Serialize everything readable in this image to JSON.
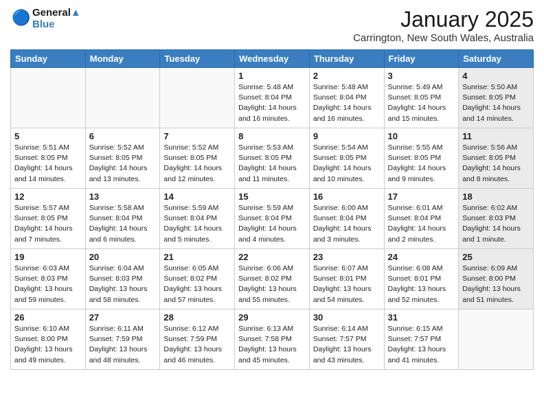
{
  "header": {
    "logo_line1": "General",
    "logo_line2": "Blue",
    "title": "January 2025",
    "subtitle": "Carrington, New South Wales, Australia"
  },
  "weekdays": [
    "Sunday",
    "Monday",
    "Tuesday",
    "Wednesday",
    "Thursday",
    "Friday",
    "Saturday"
  ],
  "weeks": [
    [
      {
        "day": "",
        "info": "",
        "shaded": false,
        "empty": true
      },
      {
        "day": "",
        "info": "",
        "shaded": false,
        "empty": true
      },
      {
        "day": "",
        "info": "",
        "shaded": false,
        "empty": true
      },
      {
        "day": "1",
        "info": "Sunrise: 5:48 AM\nSunset: 8:04 PM\nDaylight: 14 hours\nand 16 minutes.",
        "shaded": false
      },
      {
        "day": "2",
        "info": "Sunrise: 5:48 AM\nSunset: 8:04 PM\nDaylight: 14 hours\nand 16 minutes.",
        "shaded": false
      },
      {
        "day": "3",
        "info": "Sunrise: 5:49 AM\nSunset: 8:05 PM\nDaylight: 14 hours\nand 15 minutes.",
        "shaded": false
      },
      {
        "day": "4",
        "info": "Sunrise: 5:50 AM\nSunset: 8:05 PM\nDaylight: 14 hours\nand 14 minutes.",
        "shaded": true
      }
    ],
    [
      {
        "day": "5",
        "info": "Sunrise: 5:51 AM\nSunset: 8:05 PM\nDaylight: 14 hours\nand 14 minutes.",
        "shaded": false
      },
      {
        "day": "6",
        "info": "Sunrise: 5:52 AM\nSunset: 8:05 PM\nDaylight: 14 hours\nand 13 minutes.",
        "shaded": false
      },
      {
        "day": "7",
        "info": "Sunrise: 5:52 AM\nSunset: 8:05 PM\nDaylight: 14 hours\nand 12 minutes.",
        "shaded": false
      },
      {
        "day": "8",
        "info": "Sunrise: 5:53 AM\nSunset: 8:05 PM\nDaylight: 14 hours\nand 11 minutes.",
        "shaded": false
      },
      {
        "day": "9",
        "info": "Sunrise: 5:54 AM\nSunset: 8:05 PM\nDaylight: 14 hours\nand 10 minutes.",
        "shaded": false
      },
      {
        "day": "10",
        "info": "Sunrise: 5:55 AM\nSunset: 8:05 PM\nDaylight: 14 hours\nand 9 minutes.",
        "shaded": false
      },
      {
        "day": "11",
        "info": "Sunrise: 5:56 AM\nSunset: 8:05 PM\nDaylight: 14 hours\nand 8 minutes.",
        "shaded": true
      }
    ],
    [
      {
        "day": "12",
        "info": "Sunrise: 5:57 AM\nSunset: 8:05 PM\nDaylight: 14 hours\nand 7 minutes.",
        "shaded": false
      },
      {
        "day": "13",
        "info": "Sunrise: 5:58 AM\nSunset: 8:04 PM\nDaylight: 14 hours\nand 6 minutes.",
        "shaded": false
      },
      {
        "day": "14",
        "info": "Sunrise: 5:59 AM\nSunset: 8:04 PM\nDaylight: 14 hours\nand 5 minutes.",
        "shaded": false
      },
      {
        "day": "15",
        "info": "Sunrise: 5:59 AM\nSunset: 8:04 PM\nDaylight: 14 hours\nand 4 minutes.",
        "shaded": false
      },
      {
        "day": "16",
        "info": "Sunrise: 6:00 AM\nSunset: 8:04 PM\nDaylight: 14 hours\nand 3 minutes.",
        "shaded": false
      },
      {
        "day": "17",
        "info": "Sunrise: 6:01 AM\nSunset: 8:04 PM\nDaylight: 14 hours\nand 2 minutes.",
        "shaded": false
      },
      {
        "day": "18",
        "info": "Sunrise: 6:02 AM\nSunset: 8:03 PM\nDaylight: 14 hours\nand 1 minute.",
        "shaded": true
      }
    ],
    [
      {
        "day": "19",
        "info": "Sunrise: 6:03 AM\nSunset: 8:03 PM\nDaylight: 13 hours\nand 59 minutes.",
        "shaded": false
      },
      {
        "day": "20",
        "info": "Sunrise: 6:04 AM\nSunset: 8:03 PM\nDaylight: 13 hours\nand 58 minutes.",
        "shaded": false
      },
      {
        "day": "21",
        "info": "Sunrise: 6:05 AM\nSunset: 8:02 PM\nDaylight: 13 hours\nand 57 minutes.",
        "shaded": false
      },
      {
        "day": "22",
        "info": "Sunrise: 6:06 AM\nSunset: 8:02 PM\nDaylight: 13 hours\nand 55 minutes.",
        "shaded": false
      },
      {
        "day": "23",
        "info": "Sunrise: 6:07 AM\nSunset: 8:01 PM\nDaylight: 13 hours\nand 54 minutes.",
        "shaded": false
      },
      {
        "day": "24",
        "info": "Sunrise: 6:08 AM\nSunset: 8:01 PM\nDaylight: 13 hours\nand 52 minutes.",
        "shaded": false
      },
      {
        "day": "25",
        "info": "Sunrise: 6:09 AM\nSunset: 8:00 PM\nDaylight: 13 hours\nand 51 minutes.",
        "shaded": true
      }
    ],
    [
      {
        "day": "26",
        "info": "Sunrise: 6:10 AM\nSunset: 8:00 PM\nDaylight: 13 hours\nand 49 minutes.",
        "shaded": false
      },
      {
        "day": "27",
        "info": "Sunrise: 6:11 AM\nSunset: 7:59 PM\nDaylight: 13 hours\nand 48 minutes.",
        "shaded": false
      },
      {
        "day": "28",
        "info": "Sunrise: 6:12 AM\nSunset: 7:59 PM\nDaylight: 13 hours\nand 46 minutes.",
        "shaded": false
      },
      {
        "day": "29",
        "info": "Sunrise: 6:13 AM\nSunset: 7:58 PM\nDaylight: 13 hours\nand 45 minutes.",
        "shaded": false
      },
      {
        "day": "30",
        "info": "Sunrise: 6:14 AM\nSunset: 7:57 PM\nDaylight: 13 hours\nand 43 minutes.",
        "shaded": false
      },
      {
        "day": "31",
        "info": "Sunrise: 6:15 AM\nSunset: 7:57 PM\nDaylight: 13 hours\nand 41 minutes.",
        "shaded": false
      },
      {
        "day": "",
        "info": "",
        "shaded": true,
        "empty": true
      }
    ]
  ]
}
